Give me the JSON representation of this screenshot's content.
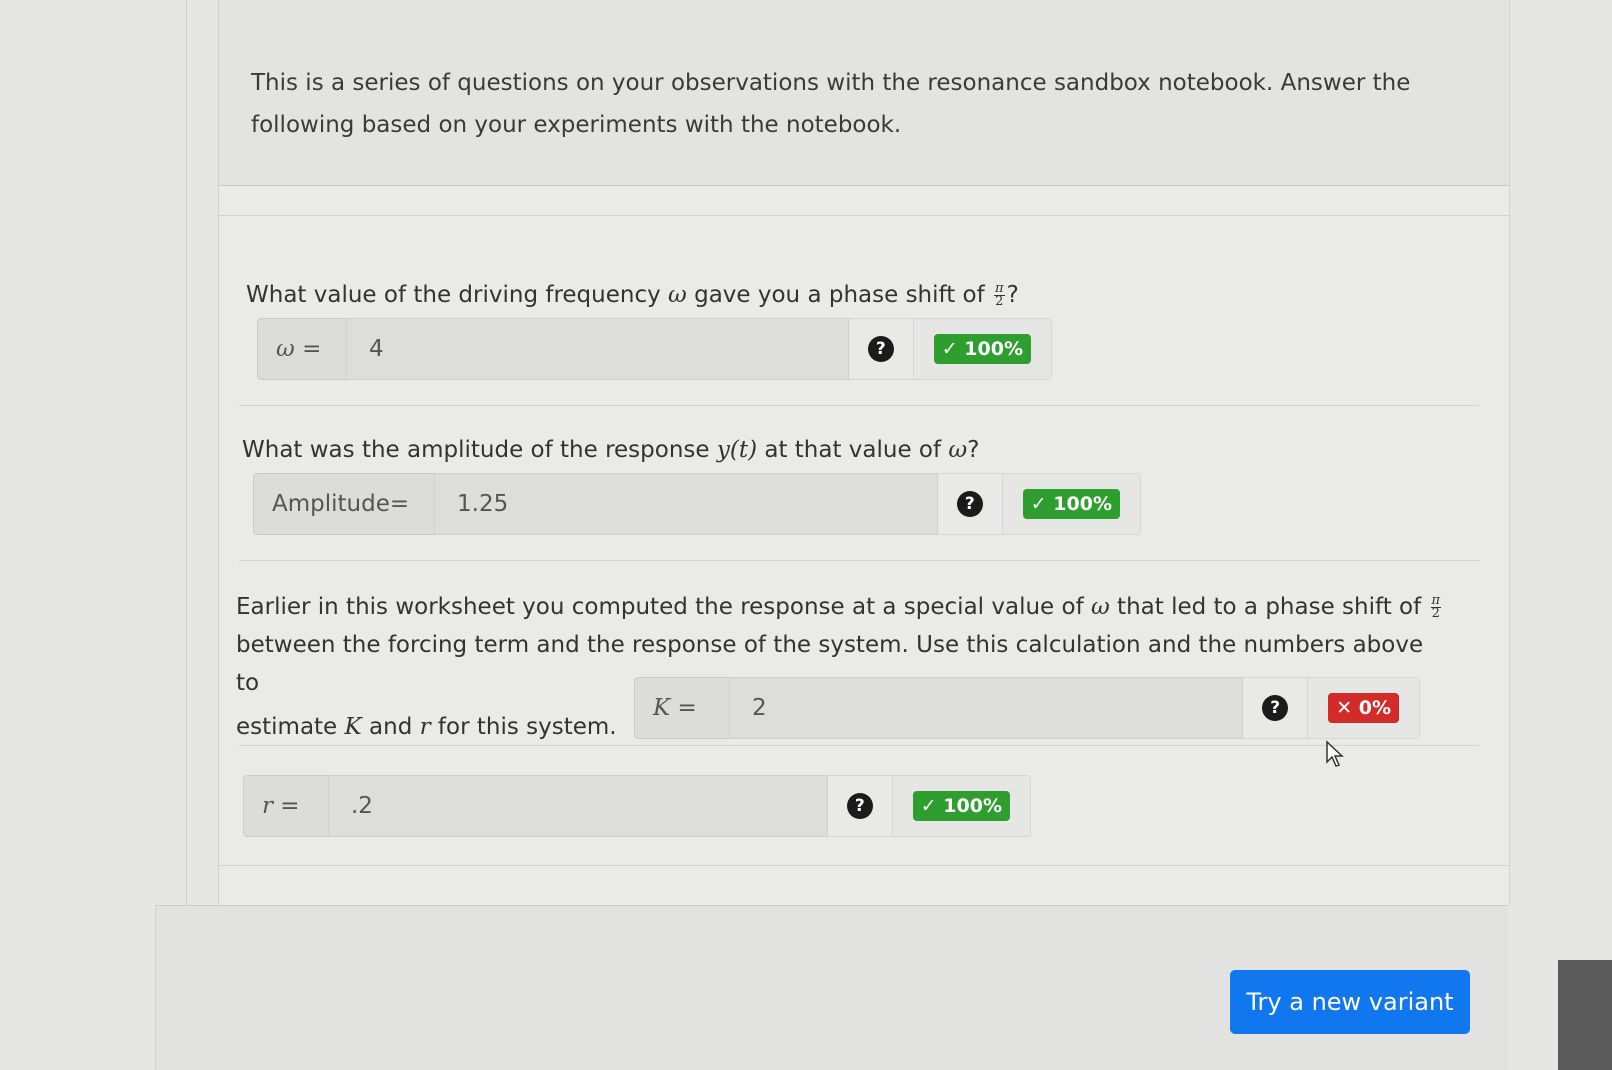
{
  "intro": {
    "text": "This is a series of questions on your observations with the resonance sandbox notebook. Answer the following based on your experiments with the notebook."
  },
  "q1": {
    "text_before": "What value of the driving frequency ",
    "omega": "ω",
    "text_middle": " gave you a phase shift of ",
    "frac_num": "π",
    "frac_den": "2",
    "text_after": "?",
    "label": "ω =",
    "value": "4",
    "help": "?",
    "score": "✓ 100%",
    "status": "correct"
  },
  "q2": {
    "text_before": "What was the amplitude of the response ",
    "func": "y(t)",
    "text_middle": " at that value of ",
    "omega": "ω",
    "text_after": "?",
    "label": "Amplitude=",
    "value": "1.25",
    "help": "?",
    "score": "✓ 100%",
    "status": "correct"
  },
  "q3": {
    "line1_before": "Earlier in this worksheet you computed the response at a special value of ",
    "omega": "ω",
    "line1_after": " that led to a phase shift of ",
    "frac_num": "π",
    "frac_den": "2",
    "line2": "between the forcing term and the response of the system. Use this calculation and the numbers above to",
    "line3_before": "estimate ",
    "K": "K",
    "line3_mid": " and ",
    "r": "r",
    "line3_after": " for this system.",
    "k_field": {
      "label": "K =",
      "value": "2",
      "help": "?",
      "score": "✕ 0%",
      "status": "incorrect"
    },
    "r_field": {
      "label": "r =",
      "value": ".2",
      "help": "?",
      "score": "✓ 100%",
      "status": "correct"
    }
  },
  "actions": {
    "new_variant": "Try a new variant"
  },
  "colors": {
    "correct": "#2e9e2e",
    "incorrect": "#d32a2a",
    "primary": "#1177ee"
  }
}
